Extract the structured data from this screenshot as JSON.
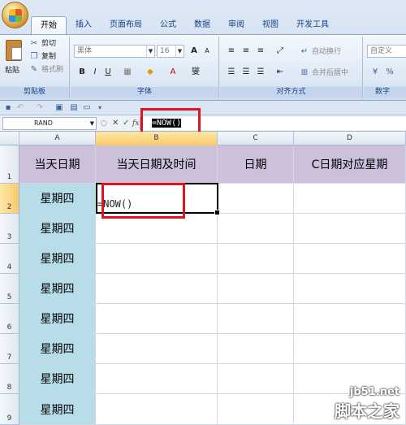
{
  "ribbon": {
    "tabs": [
      "开始",
      "插入",
      "页面布局",
      "公式",
      "数据",
      "审阅",
      "视图",
      "开发工具"
    ],
    "active_tab": "开始",
    "clipboard": {
      "paste": "粘贴",
      "cut": "剪切",
      "copy": "复制",
      "format_painter": "格式刷",
      "label": "剪贴板"
    },
    "font": {
      "name": "黑体",
      "size": "16",
      "label": "字体",
      "bold": "B",
      "italic": "I",
      "underline": "U",
      "grow": "A",
      "shrink": "A",
      "phonetic": "燮"
    },
    "alignment": {
      "wrap_text": "自动换行",
      "merge_center": "合并后居中",
      "label": "对齐方式"
    },
    "number": {
      "format": "自定义",
      "label": "数字"
    }
  },
  "formula_bar": {
    "name_box": "RAND",
    "fx": "fx",
    "formula": "=NOW()"
  },
  "sheet": {
    "columns": [
      "A",
      "B",
      "C",
      "D"
    ],
    "rows": [
      "1",
      "2",
      "3",
      "4",
      "5",
      "6",
      "7",
      "8",
      "9"
    ],
    "header_row": [
      "当天日期",
      "当天日期及时间",
      "日期",
      "C日期对应星期"
    ],
    "column_a": [
      "星期四",
      "星期四",
      "星期四",
      "星期四",
      "星期四",
      "星期四",
      "星期四",
      "星期四"
    ],
    "editing_cell": "B2",
    "editing_text": "=NOW()"
  },
  "watermark": {
    "url": "jb51.net",
    "text": "脚本之家"
  },
  "colors": {
    "header_fill": "#ccc0da",
    "weekday_fill": "#b7dde8",
    "highlight_box": "#e0141e"
  }
}
